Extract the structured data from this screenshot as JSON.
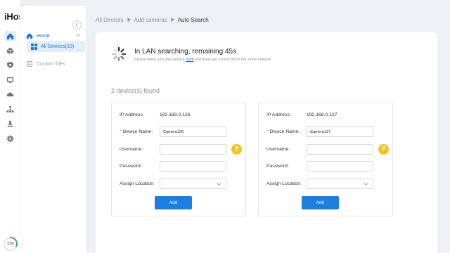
{
  "app": {
    "brand": "iHost"
  },
  "rail": {
    "items": [
      {
        "icon": "home-icon",
        "active": true
      },
      {
        "icon": "cube-icon"
      },
      {
        "icon": "shield-icon"
      },
      {
        "icon": "monitor-icon"
      },
      {
        "icon": "cloud-icon"
      },
      {
        "icon": "network-icon"
      },
      {
        "icon": "flask-icon"
      },
      {
        "icon": "gear-icon"
      }
    ],
    "usage_label": "31%",
    "usage_fraction": 0.31
  },
  "sidebar": {
    "home_label": "Home",
    "all_devices_label": "All Devices(10)",
    "custom_tiles_label": "Custom Tiles"
  },
  "breadcrumb": {
    "items": [
      "All Devices",
      "Add cameras",
      "Auto Search"
    ]
  },
  "search": {
    "title": "In LAN searching, remaining 45s",
    "hint_before": "Please make sure the camera ",
    "hint_highlight": "onvif",
    "hint_after": " and iHost are connected to the same network",
    "found_text": "2 device(s) found"
  },
  "labels": {
    "ip": "IP Address:",
    "device_name": "Device Name:",
    "username": "Username:",
    "password": "Password:",
    "assign_location": "Assign Location:",
    "required_mark": "*",
    "add": "Add",
    "help": "?"
  },
  "devices": [
    {
      "ip": "192.168.0.126",
      "name": "Camera126",
      "username": "",
      "password": "",
      "location": ""
    },
    {
      "ip": "192.168.0.127",
      "name": "Camera127",
      "username": "",
      "password": "",
      "location": ""
    }
  ],
  "colors": {
    "accent": "#1a73d9",
    "button": "#1a7fe0",
    "help": "#f6c21b",
    "required": "#e53935",
    "gauge": "#4caf50"
  }
}
